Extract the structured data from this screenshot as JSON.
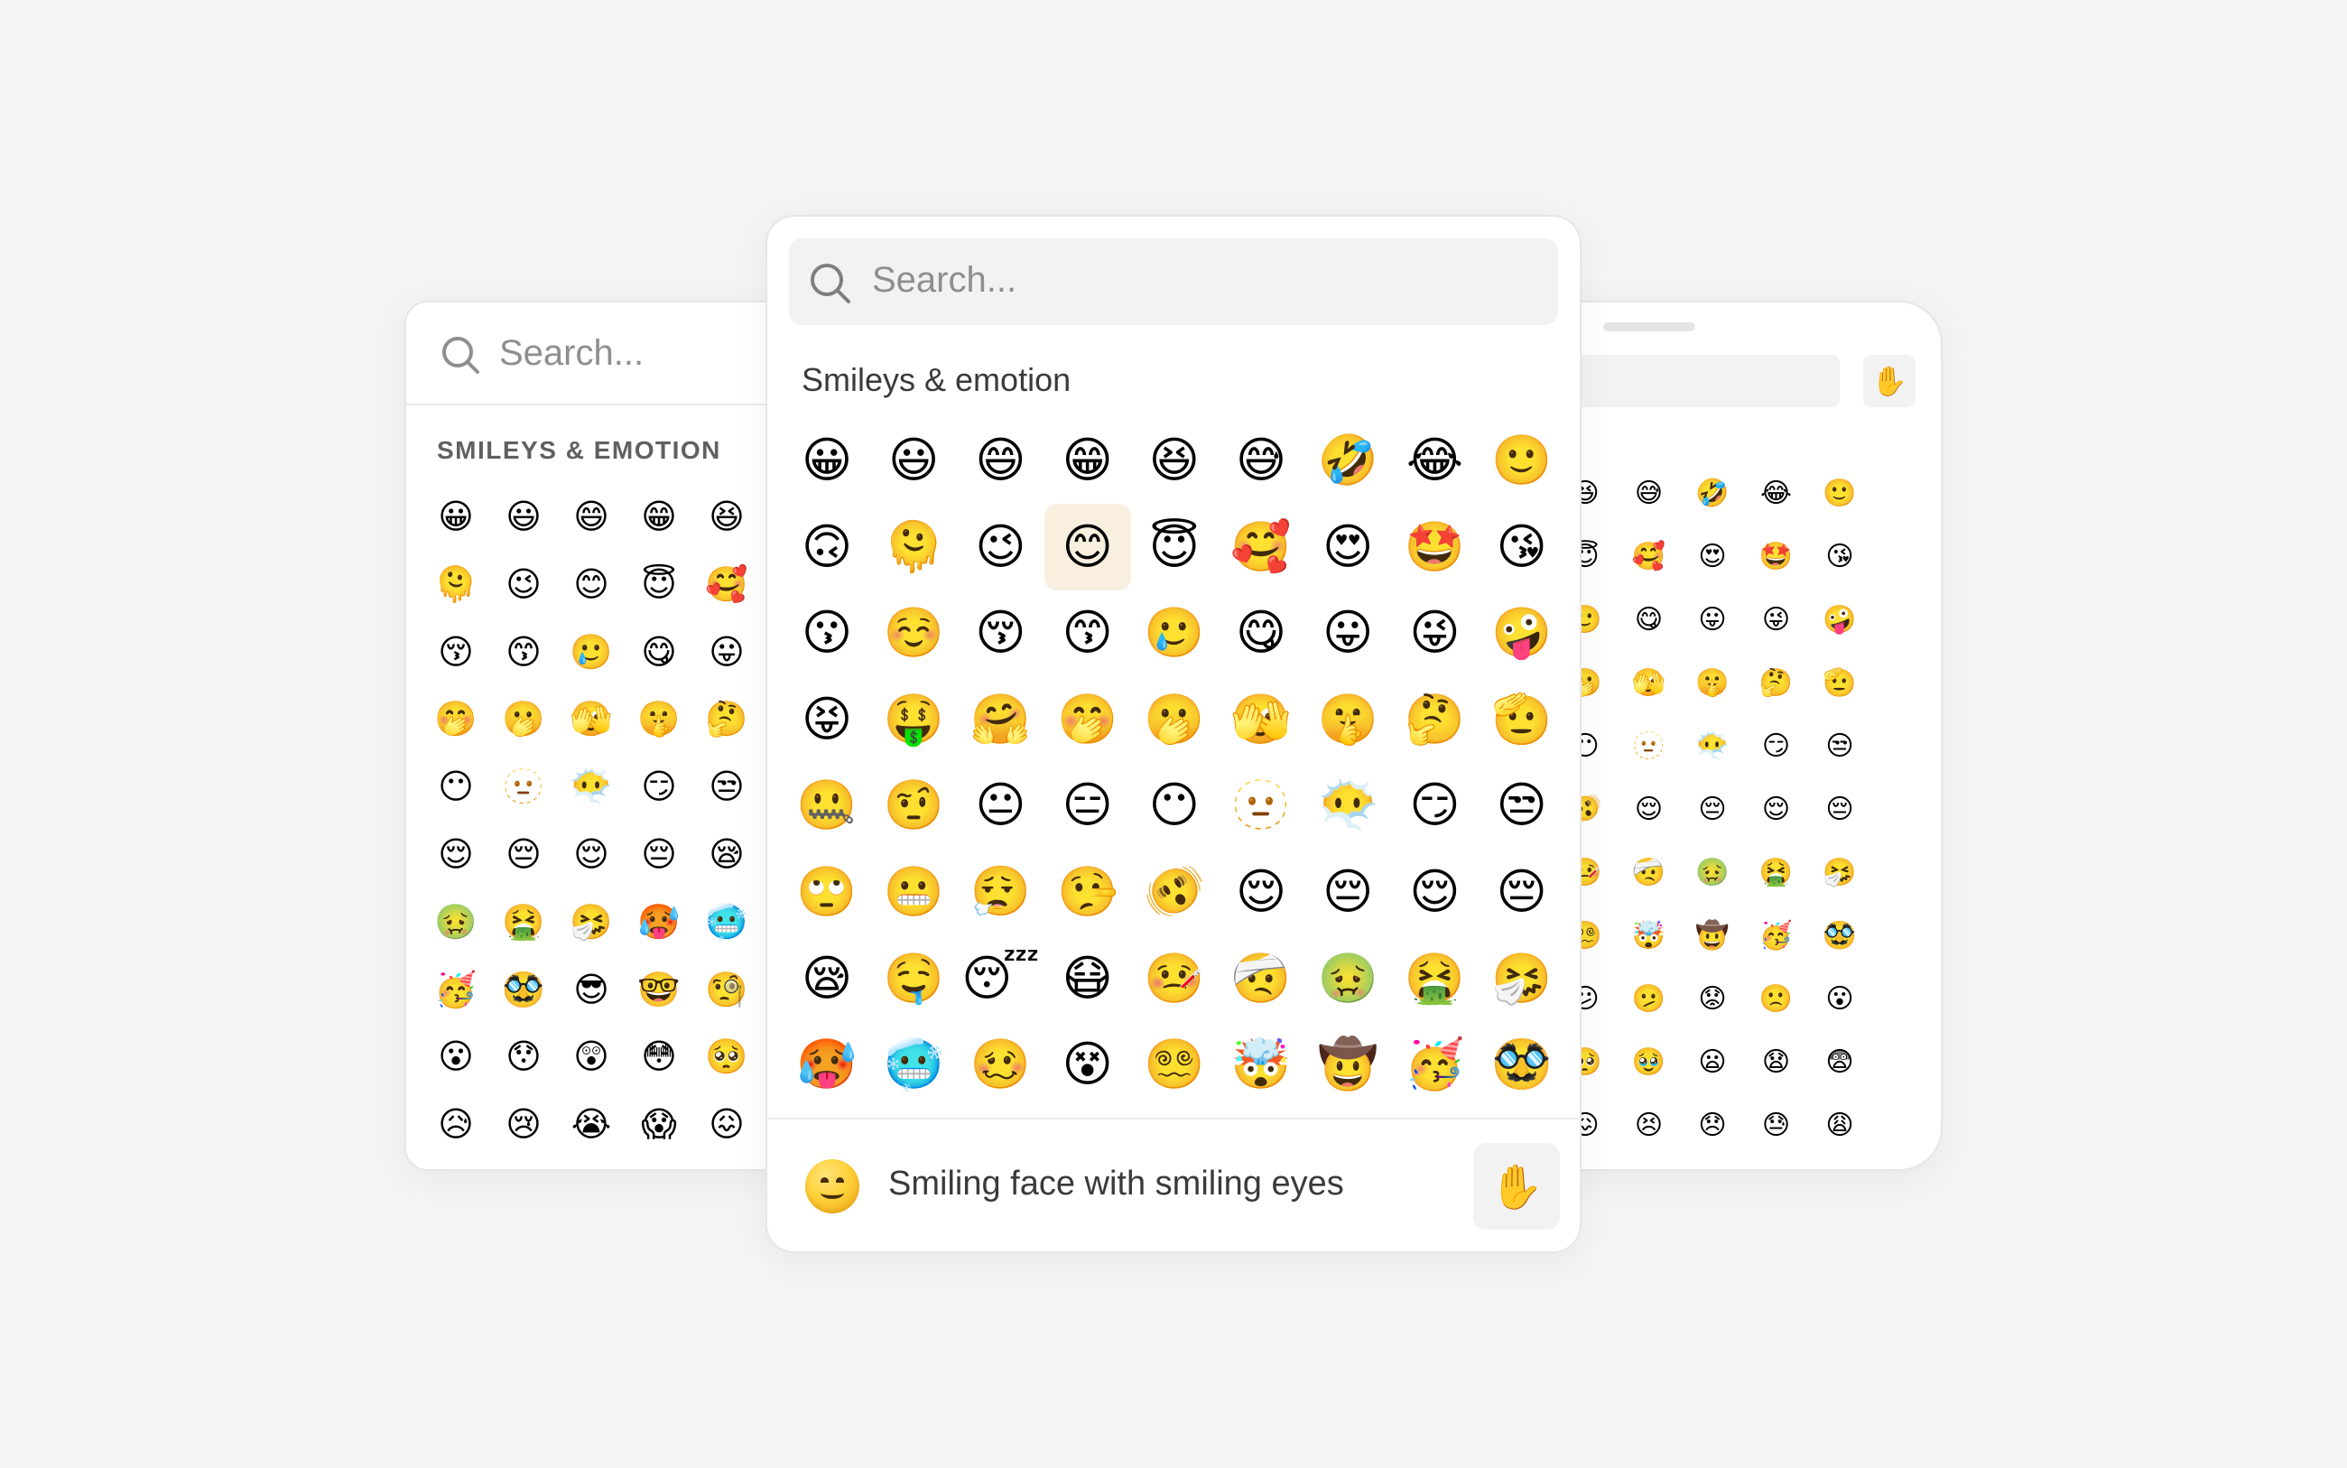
{
  "search": {
    "placeholder": "Search..."
  },
  "left_panel": {
    "category_title": "SMILEYS & EMOTION"
  },
  "center_panel": {
    "category_title": "Smileys & emotion",
    "selected": {
      "name": "Smiling face with smiling eyes",
      "emoji": "😊",
      "row": 1,
      "col": 3
    },
    "skin_tone_emoji": "✋"
  },
  "right_panel": {
    "skin_tone_emoji": "✋"
  },
  "emoji_grid": [
    [
      "😀",
      "😃",
      "😄",
      "😁",
      "😆",
      "😅",
      "🤣",
      "😂",
      "🙂"
    ],
    [
      "🙃",
      "🫠",
      "😉",
      "😊",
      "😇",
      "🥰",
      "😍",
      "🤩",
      "😘"
    ],
    [
      "😗",
      "☺️",
      "😚",
      "😙",
      "🥲",
      "😋",
      "😛",
      "😜",
      "🤪"
    ],
    [
      "😝",
      "🤑",
      "🤗",
      "🤭",
      "🫢",
      "🫣",
      "🤫",
      "🤔",
      "🫡"
    ],
    [
      "🤐",
      "🤨",
      "😐",
      "😑",
      "😶",
      "🫥",
      "😶‍🌫️",
      "😏",
      "😒"
    ],
    [
      "🙄",
      "😬",
      "😮‍💨",
      "🤥",
      "🫨",
      "😌",
      "😔",
      "😌",
      "😔"
    ],
    [
      "😪",
      "🤤",
      "😴",
      "😷",
      "🤒",
      "🤕",
      "🤢",
      "🤮",
      "🤧"
    ],
    [
      "🥵",
      "🥶",
      "🥴",
      "😵",
      "😵‍💫",
      "🤯",
      "🤠",
      "🥳",
      "🥸"
    ]
  ],
  "left_grid": [
    [
      "😀",
      "😃",
      "😄",
      "😁",
      "😆"
    ],
    [
      "🫠",
      "😉",
      "😊",
      "😇",
      "🥰"
    ],
    [
      "😚",
      "😙",
      "🥲",
      "😋",
      "😛"
    ],
    [
      "🤭",
      "🫢",
      "🫣",
      "🤫",
      "🤔"
    ],
    [
      "😶",
      "🫥",
      "😶‍🌫️",
      "😏",
      "😒"
    ],
    [
      "😌",
      "😔",
      "😌",
      "😔",
      "😪"
    ],
    [
      "🤢",
      "🤮",
      "🤧",
      "🥵",
      "🥶"
    ],
    [
      "🥳",
      "🥸",
      "😎",
      "🤓",
      "🧐"
    ],
    [
      "😮",
      "😯",
      "😲",
      "😳",
      "🥺"
    ],
    [
      "😥",
      "😢",
      "😭",
      "😱",
      "😖"
    ]
  ],
  "right_grid": [
    [
      "😆",
      "😅",
      "🤣",
      "😂",
      "🙂"
    ],
    [
      "😇",
      "🥰",
      "😍",
      "🤩",
      "😘"
    ],
    [
      "🥲",
      "😋",
      "😛",
      "😜",
      "🤪"
    ],
    [
      "🫢",
      "🫣",
      "🤫",
      "🤔",
      "🫡"
    ],
    [
      "😶",
      "🫥",
      "😶‍🌫️",
      "😏",
      "😒"
    ],
    [
      "🫨",
      "😌",
      "😔",
      "😌",
      "😔"
    ],
    [
      "🤒",
      "🤕",
      "🤢",
      "🤮",
      "🤧"
    ],
    [
      "😵‍💫",
      "🤯",
      "🤠",
      "🥳",
      "🥸"
    ],
    [
      "😕",
      "🫤",
      "😟",
      "🙁",
      "😮"
    ],
    [
      "🥺",
      "🥹",
      "😦",
      "😧",
      "😨"
    ],
    [
      "😖",
      "😣",
      "😞",
      "😓",
      "😩"
    ]
  ],
  "colors": {
    "background": "#f4f4f4",
    "highlight": "#f8efdf",
    "search_bg": "#f2f2f2"
  }
}
